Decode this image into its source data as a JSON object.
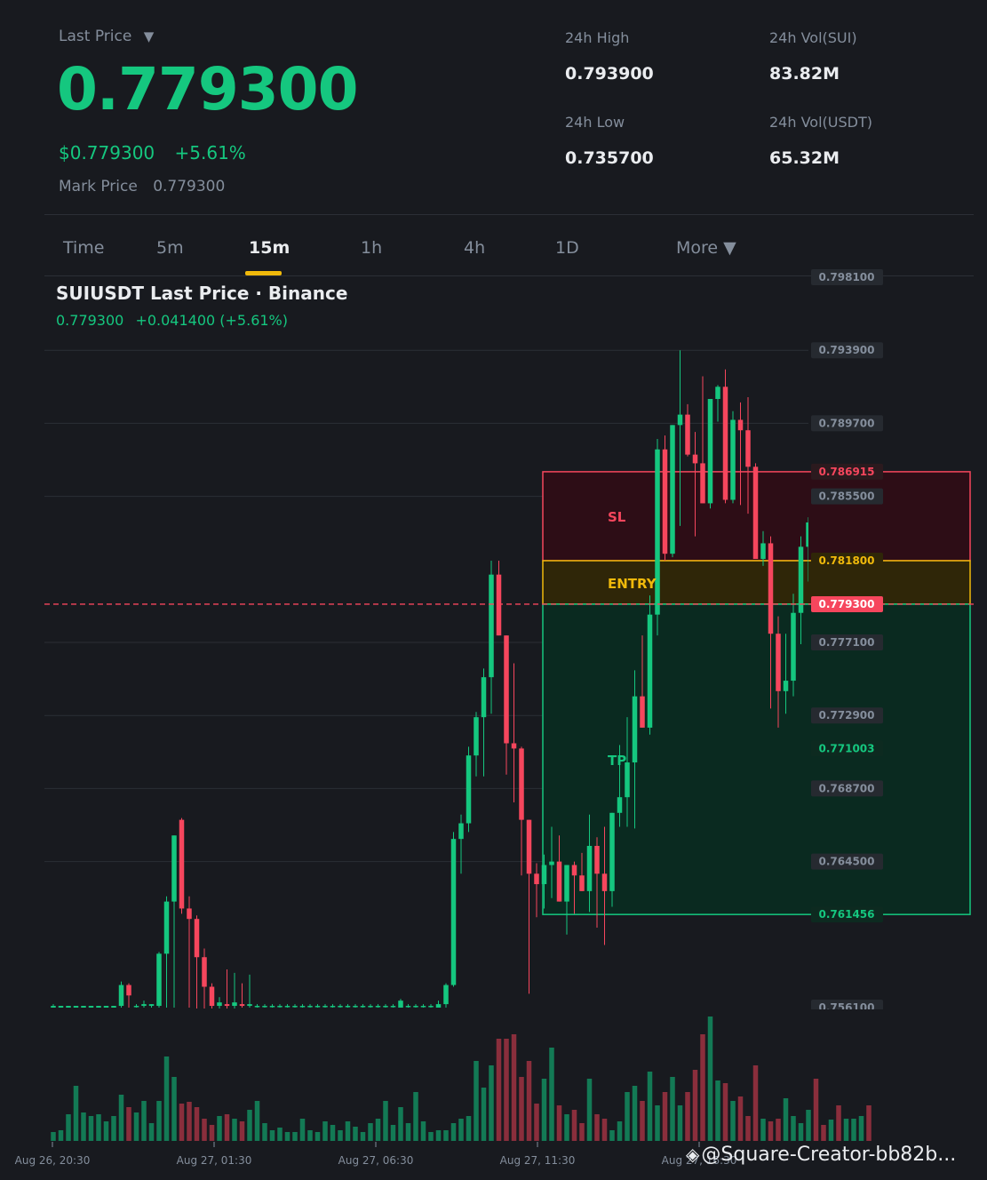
{
  "header": {
    "last_price_label": "Last Price",
    "dropdown_arrow": "▼",
    "last_price": "0.779300",
    "usd_price": "$0.779300",
    "change_pct": "+5.61%",
    "mark_price_label": "Mark Price",
    "mark_price": "0.779300",
    "stats": [
      {
        "label": "24h High",
        "value": "0.793900"
      },
      {
        "label": "24h Vol(SUI)",
        "value": "83.82M"
      },
      {
        "label": "24h Low",
        "value": "0.735700"
      },
      {
        "label": "24h Vol(USDT)",
        "value": "65.32M"
      }
    ]
  },
  "tabs": [
    {
      "label": "Time",
      "active": false
    },
    {
      "label": "5m",
      "active": false
    },
    {
      "label": "15m",
      "active": true
    },
    {
      "label": "1h",
      "active": false
    },
    {
      "label": "4h",
      "active": false
    },
    {
      "label": "1D",
      "active": false
    },
    {
      "label": "More ▼",
      "active": false
    }
  ],
  "chart_title": "SUIUSDT Last Price · Binance",
  "chart_subtitle": {
    "price": "0.779300",
    "change": "+0.041400 (+5.61%)"
  },
  "watermark": "@Square-Creator-bb82b...",
  "colors": {
    "up": "#15c77f",
    "down": "#f6465d",
    "entry": "#f0b90b",
    "bg": "#181a1f"
  },
  "chart_data": {
    "type": "candlestick",
    "symbol": "SUIUSDT",
    "interval": "15m",
    "ylim": [
      0.7561,
      0.7981
    ],
    "y_ticks": [
      "0.798100",
      "0.793900",
      "0.789700",
      "0.785500",
      "0.777100",
      "0.772900",
      "0.768700",
      "0.764500",
      "0.756100"
    ],
    "x_tick_labels": [
      "Aug 26, 20:30",
      "Aug 27, 01:30",
      "Aug 27, 06:30",
      "Aug 27, 11:30",
      "Aug 27, 16:30"
    ],
    "current_price": "0.779300",
    "zones": [
      {
        "name": "SL",
        "top": 0.786915,
        "bottom": 0.7818,
        "color": "#f6465d",
        "label": "SL"
      },
      {
        "name": "ENTRY",
        "top": 0.7818,
        "bottom": 0.7793,
        "color": "#f0b90b",
        "label": "ENTRY"
      },
      {
        "name": "TP",
        "top": 0.7793,
        "bottom": 0.761456,
        "color": "#15c77f",
        "label": "TP"
      }
    ],
    "zone_prices": [
      "0.786915",
      "0.781800",
      "0.771003",
      "0.761456"
    ],
    "candles": [
      {
        "o": 0.7561,
        "h": 0.7563,
        "l": 0.7561,
        "c": 0.7562,
        "v": 10
      },
      {
        "o": 0.7561,
        "h": 0.7562,
        "l": 0.7561,
        "c": 0.7562,
        "v": 12
      },
      {
        "o": 0.7561,
        "h": 0.7562,
        "l": 0.7561,
        "c": 0.7562,
        "v": 30
      },
      {
        "o": 0.7561,
        "h": 0.7562,
        "l": 0.7561,
        "c": 0.7562,
        "v": 62
      },
      {
        "o": 0.7561,
        "h": 0.7562,
        "l": 0.7561,
        "c": 0.7562,
        "v": 32
      },
      {
        "o": 0.7561,
        "h": 0.7562,
        "l": 0.7561,
        "c": 0.7562,
        "v": 28
      },
      {
        "o": 0.7561,
        "h": 0.7562,
        "l": 0.7561,
        "c": 0.7562,
        "v": 30
      },
      {
        "o": 0.7561,
        "h": 0.7562,
        "l": 0.7561,
        "c": 0.7562,
        "v": 22
      },
      {
        "o": 0.7561,
        "h": 0.7562,
        "l": 0.7561,
        "c": 0.7562,
        "v": 28
      },
      {
        "o": 0.7562,
        "h": 0.7576,
        "l": 0.7561,
        "c": 0.7574,
        "v": 52
      },
      {
        "o": 0.7574,
        "h": 0.7575,
        "l": 0.7561,
        "c": 0.7568,
        "v": 38
      },
      {
        "o": 0.7562,
        "h": 0.7563,
        "l": 0.7561,
        "c": 0.7562,
        "v": 32
      },
      {
        "o": 0.7562,
        "h": 0.7565,
        "l": 0.7561,
        "c": 0.7563,
        "v": 45
      },
      {
        "o": 0.7562,
        "h": 0.7563,
        "l": 0.7561,
        "c": 0.7563,
        "v": 20
      },
      {
        "o": 0.7562,
        "h": 0.7593,
        "l": 0.7561,
        "c": 0.7592,
        "v": 45
      },
      {
        "o": 0.7592,
        "h": 0.7625,
        "l": 0.7561,
        "c": 0.7622,
        "v": 95
      },
      {
        "o": 0.7622,
        "h": 0.7651,
        "l": 0.7561,
        "c": 0.766,
        "v": 72
      },
      {
        "o": 0.7669,
        "h": 0.767,
        "l": 0.7615,
        "c": 0.7618,
        "v": 42
      },
      {
        "o": 0.7618,
        "h": 0.7625,
        "l": 0.7561,
        "c": 0.7612,
        "v": 44
      },
      {
        "o": 0.7612,
        "h": 0.7614,
        "l": 0.756,
        "c": 0.759,
        "v": 38
      },
      {
        "o": 0.759,
        "h": 0.7595,
        "l": 0.756,
        "c": 0.7573,
        "v": 25
      },
      {
        "o": 0.7573,
        "h": 0.7575,
        "l": 0.756,
        "c": 0.7562,
        "v": 18
      },
      {
        "o": 0.7562,
        "h": 0.7567,
        "l": 0.756,
        "c": 0.7564,
        "v": 28
      },
      {
        "o": 0.7563,
        "h": 0.7583,
        "l": 0.756,
        "c": 0.7562,
        "v": 30
      },
      {
        "o": 0.7562,
        "h": 0.7581,
        "l": 0.756,
        "c": 0.7564,
        "v": 25
      },
      {
        "o": 0.7563,
        "h": 0.7575,
        "l": 0.7561,
        "c": 0.7562,
        "v": 22
      },
      {
        "o": 0.7562,
        "h": 0.758,
        "l": 0.7561,
        "c": 0.7563,
        "v": 35
      },
      {
        "o": 0.7562,
        "h": 0.7563,
        "l": 0.7561,
        "c": 0.7562,
        "v": 45
      },
      {
        "o": 0.7562,
        "h": 0.7563,
        "l": 0.7561,
        "c": 0.7562,
        "v": 20
      },
      {
        "o": 0.7562,
        "h": 0.7563,
        "l": 0.7561,
        "c": 0.7562,
        "v": 12
      },
      {
        "o": 0.7562,
        "h": 0.7563,
        "l": 0.7561,
        "c": 0.7562,
        "v": 15
      },
      {
        "o": 0.7562,
        "h": 0.7563,
        "l": 0.7561,
        "c": 0.7562,
        "v": 10
      },
      {
        "o": 0.7562,
        "h": 0.7563,
        "l": 0.7561,
        "c": 0.7562,
        "v": 10
      },
      {
        "o": 0.7562,
        "h": 0.7563,
        "l": 0.7561,
        "c": 0.7562,
        "v": 25
      },
      {
        "o": 0.7562,
        "h": 0.7563,
        "l": 0.7561,
        "c": 0.7562,
        "v": 12
      },
      {
        "o": 0.7562,
        "h": 0.7563,
        "l": 0.7561,
        "c": 0.7562,
        "v": 10
      },
      {
        "o": 0.7562,
        "h": 0.7563,
        "l": 0.7561,
        "c": 0.7562,
        "v": 22
      },
      {
        "o": 0.7562,
        "h": 0.7563,
        "l": 0.7561,
        "c": 0.7562,
        "v": 18
      },
      {
        "o": 0.7562,
        "h": 0.7563,
        "l": 0.7561,
        "c": 0.7562,
        "v": 12
      },
      {
        "o": 0.7562,
        "h": 0.7563,
        "l": 0.7561,
        "c": 0.7562,
        "v": 22
      },
      {
        "o": 0.7562,
        "h": 0.7563,
        "l": 0.7561,
        "c": 0.7562,
        "v": 16
      },
      {
        "o": 0.7562,
        "h": 0.7563,
        "l": 0.7561,
        "c": 0.7562,
        "v": 10
      },
      {
        "o": 0.7562,
        "h": 0.7563,
        "l": 0.7561,
        "c": 0.7562,
        "v": 20
      },
      {
        "o": 0.7562,
        "h": 0.7563,
        "l": 0.7561,
        "c": 0.7562,
        "v": 25
      },
      {
        "o": 0.7562,
        "h": 0.7563,
        "l": 0.7561,
        "c": 0.7562,
        "v": 45
      },
      {
        "o": 0.7562,
        "h": 0.7563,
        "l": 0.7561,
        "c": 0.7562,
        "v": 18
      },
      {
        "o": 0.7561,
        "h": 0.7566,
        "l": 0.7561,
        "c": 0.7565,
        "v": 38
      },
      {
        "o": 0.7562,
        "h": 0.7563,
        "l": 0.7561,
        "c": 0.7562,
        "v": 20
      },
      {
        "o": 0.7562,
        "h": 0.7563,
        "l": 0.7561,
        "c": 0.7562,
        "v": 55
      },
      {
        "o": 0.7562,
        "h": 0.7563,
        "l": 0.7561,
        "c": 0.7562,
        "v": 22
      },
      {
        "o": 0.7562,
        "h": 0.7563,
        "l": 0.7561,
        "c": 0.7562,
        "v": 10
      },
      {
        "o": 0.7561,
        "h": 0.7565,
        "l": 0.7561,
        "c": 0.7563,
        "v": 12
      },
      {
        "o": 0.7563,
        "h": 0.7575,
        "l": 0.7561,
        "c": 0.7574,
        "v": 12
      },
      {
        "o": 0.7574,
        "h": 0.7662,
        "l": 0.7573,
        "c": 0.7658,
        "v": 20
      },
      {
        "o": 0.7658,
        "h": 0.7672,
        "l": 0.7638,
        "c": 0.7667,
        "v": 25
      },
      {
        "o": 0.7667,
        "h": 0.7711,
        "l": 0.7662,
        "c": 0.7706,
        "v": 28
      },
      {
        "o": 0.7706,
        "h": 0.7731,
        "l": 0.7694,
        "c": 0.7728,
        "v": 90
      },
      {
        "o": 0.7728,
        "h": 0.7756,
        "l": 0.7694,
        "c": 0.7751,
        "v": 60
      },
      {
        "o": 0.7751,
        "h": 0.7818,
        "l": 0.773,
        "c": 0.781,
        "v": 85
      },
      {
        "o": 0.781,
        "h": 0.7818,
        "l": 0.7778,
        "c": 0.7775,
        "v": 115
      },
      {
        "o": 0.7775,
        "h": 0.7763,
        "l": 0.7695,
        "c": 0.7713,
        "v": 115
      },
      {
        "o": 0.7713,
        "h": 0.7759,
        "l": 0.7679,
        "c": 0.771,
        "v": 120
      },
      {
        "o": 0.771,
        "h": 0.7711,
        "l": 0.7637,
        "c": 0.7669,
        "v": 72
      },
      {
        "o": 0.7669,
        "h": 0.7653,
        "l": 0.7569,
        "c": 0.7638,
        "v": 90
      },
      {
        "o": 0.7638,
        "h": 0.7644,
        "l": 0.7613,
        "c": 0.7632,
        "v": 42
      },
      {
        "o": 0.7632,
        "h": 0.7649,
        "l": 0.7618,
        "c": 0.7643,
        "v": 70
      },
      {
        "o": 0.7643,
        "h": 0.7665,
        "l": 0.7624,
        "c": 0.7645,
        "v": 105
      },
      {
        "o": 0.7645,
        "h": 0.766,
        "l": 0.7626,
        "c": 0.7622,
        "v": 40
      },
      {
        "o": 0.7622,
        "h": 0.7625,
        "l": 0.7603,
        "c": 0.7643,
        "v": 30
      },
      {
        "o": 0.7643,
        "h": 0.7645,
        "l": 0.7615,
        "c": 0.7637,
        "v": 35
      },
      {
        "o": 0.7637,
        "h": 0.765,
        "l": 0.763,
        "c": 0.7628,
        "v": 20
      },
      {
        "o": 0.7628,
        "h": 0.7672,
        "l": 0.7616,
        "c": 0.7654,
        "v": 70
      },
      {
        "o": 0.7654,
        "h": 0.7659,
        "l": 0.7607,
        "c": 0.7638,
        "v": 30
      },
      {
        "o": 0.7638,
        "h": 0.7665,
        "l": 0.7597,
        "c": 0.7628,
        "v": 25
      },
      {
        "o": 0.7628,
        "h": 0.7659,
        "l": 0.7619,
        "c": 0.7673,
        "v": 12
      },
      {
        "o": 0.7673,
        "h": 0.7712,
        "l": 0.7665,
        "c": 0.7682,
        "v": 22
      },
      {
        "o": 0.7682,
        "h": 0.7728,
        "l": 0.7665,
        "c": 0.7702,
        "v": 55
      },
      {
        "o": 0.7702,
        "h": 0.7755,
        "l": 0.7664,
        "c": 0.774,
        "v": 62
      },
      {
        "o": 0.774,
        "h": 0.7775,
        "l": 0.7722,
        "c": 0.7722,
        "v": 45
      },
      {
        "o": 0.7722,
        "h": 0.7798,
        "l": 0.7718,
        "c": 0.7787,
        "v": 78
      },
      {
        "o": 0.7787,
        "h": 0.7888,
        "l": 0.7775,
        "c": 0.7882,
        "v": 40
      },
      {
        "o": 0.7882,
        "h": 0.789,
        "l": 0.7818,
        "c": 0.7822,
        "v": 55
      },
      {
        "o": 0.7822,
        "h": 0.7896,
        "l": 0.782,
        "c": 0.7896,
        "v": 72
      },
      {
        "o": 0.7896,
        "h": 0.7939,
        "l": 0.7838,
        "c": 0.7902,
        "v": 40
      },
      {
        "o": 0.7902,
        "h": 0.7908,
        "l": 0.7878,
        "c": 0.7879,
        "v": 55
      },
      {
        "o": 0.7879,
        "h": 0.7892,
        "l": 0.7832,
        "c": 0.7874,
        "v": 80
      },
      {
        "o": 0.7874,
        "h": 0.7924,
        "l": 0.7852,
        "c": 0.7851,
        "v": 120
      },
      {
        "o": 0.7851,
        "h": 0.7878,
        "l": 0.7848,
        "c": 0.7911,
        "v": 140
      },
      {
        "o": 0.7911,
        "h": 0.7919,
        "l": 0.7898,
        "c": 0.7918,
        "v": 68
      },
      {
        "o": 0.7918,
        "h": 0.7928,
        "l": 0.7851,
        "c": 0.7853,
        "v": 65
      },
      {
        "o": 0.7853,
        "h": 0.7904,
        "l": 0.7851,
        "c": 0.7899,
        "v": 45
      },
      {
        "o": 0.7899,
        "h": 0.7909,
        "l": 0.785,
        "c": 0.7893,
        "v": 50
      },
      {
        "o": 0.7893,
        "h": 0.7912,
        "l": 0.7845,
        "c": 0.7872,
        "v": 28
      },
      {
        "o": 0.7872,
        "h": 0.7874,
        "l": 0.7832,
        "c": 0.7819,
        "v": 85
      },
      {
        "o": 0.7819,
        "h": 0.7835,
        "l": 0.7815,
        "c": 0.7828,
        "v": 25
      },
      {
        "o": 0.7828,
        "h": 0.7832,
        "l": 0.7733,
        "c": 0.7776,
        "v": 22
      },
      {
        "o": 0.7776,
        "h": 0.7786,
        "l": 0.7722,
        "c": 0.7743,
        "v": 25
      },
      {
        "o": 0.7743,
        "h": 0.7776,
        "l": 0.773,
        "c": 0.7749,
        "v": 48
      },
      {
        "o": 0.7749,
        "h": 0.7799,
        "l": 0.774,
        "c": 0.7788,
        "v": 28
      },
      {
        "o": 0.7788,
        "h": 0.7832,
        "l": 0.777,
        "c": 0.7826,
        "v": 20
      },
      {
        "o": 0.7826,
        "h": 0.7843,
        "l": 0.7806,
        "c": 0.784,
        "v": 35
      },
      {
        "o": 0.784,
        "h": 0.7842,
        "l": 0.7797,
        "c": 0.7811,
        "v": 70
      },
      {
        "o": 0.7811,
        "h": 0.7815,
        "l": 0.7758,
        "c": 0.7765,
        "v": 18
      },
      {
        "o": 0.7765,
        "h": 0.7786,
        "l": 0.7746,
        "c": 0.7795,
        "v": 24
      },
      {
        "o": 0.7795,
        "h": 0.7797,
        "l": 0.7753,
        "c": 0.7779,
        "v": 40
      },
      {
        "o": 0.7779,
        "h": 0.778,
        "l": 0.7762,
        "c": 0.7782,
        "v": 25
      },
      {
        "o": 0.7782,
        "h": 0.7798,
        "l": 0.7774,
        "c": 0.7796,
        "v": 25
      },
      {
        "o": 0.7796,
        "h": 0.7801,
        "l": 0.7784,
        "c": 0.7797,
        "v": 28
      },
      {
        "o": 0.7797,
        "h": 0.7798,
        "l": 0.7792,
        "c": 0.7793,
        "v": 40
      }
    ]
  }
}
